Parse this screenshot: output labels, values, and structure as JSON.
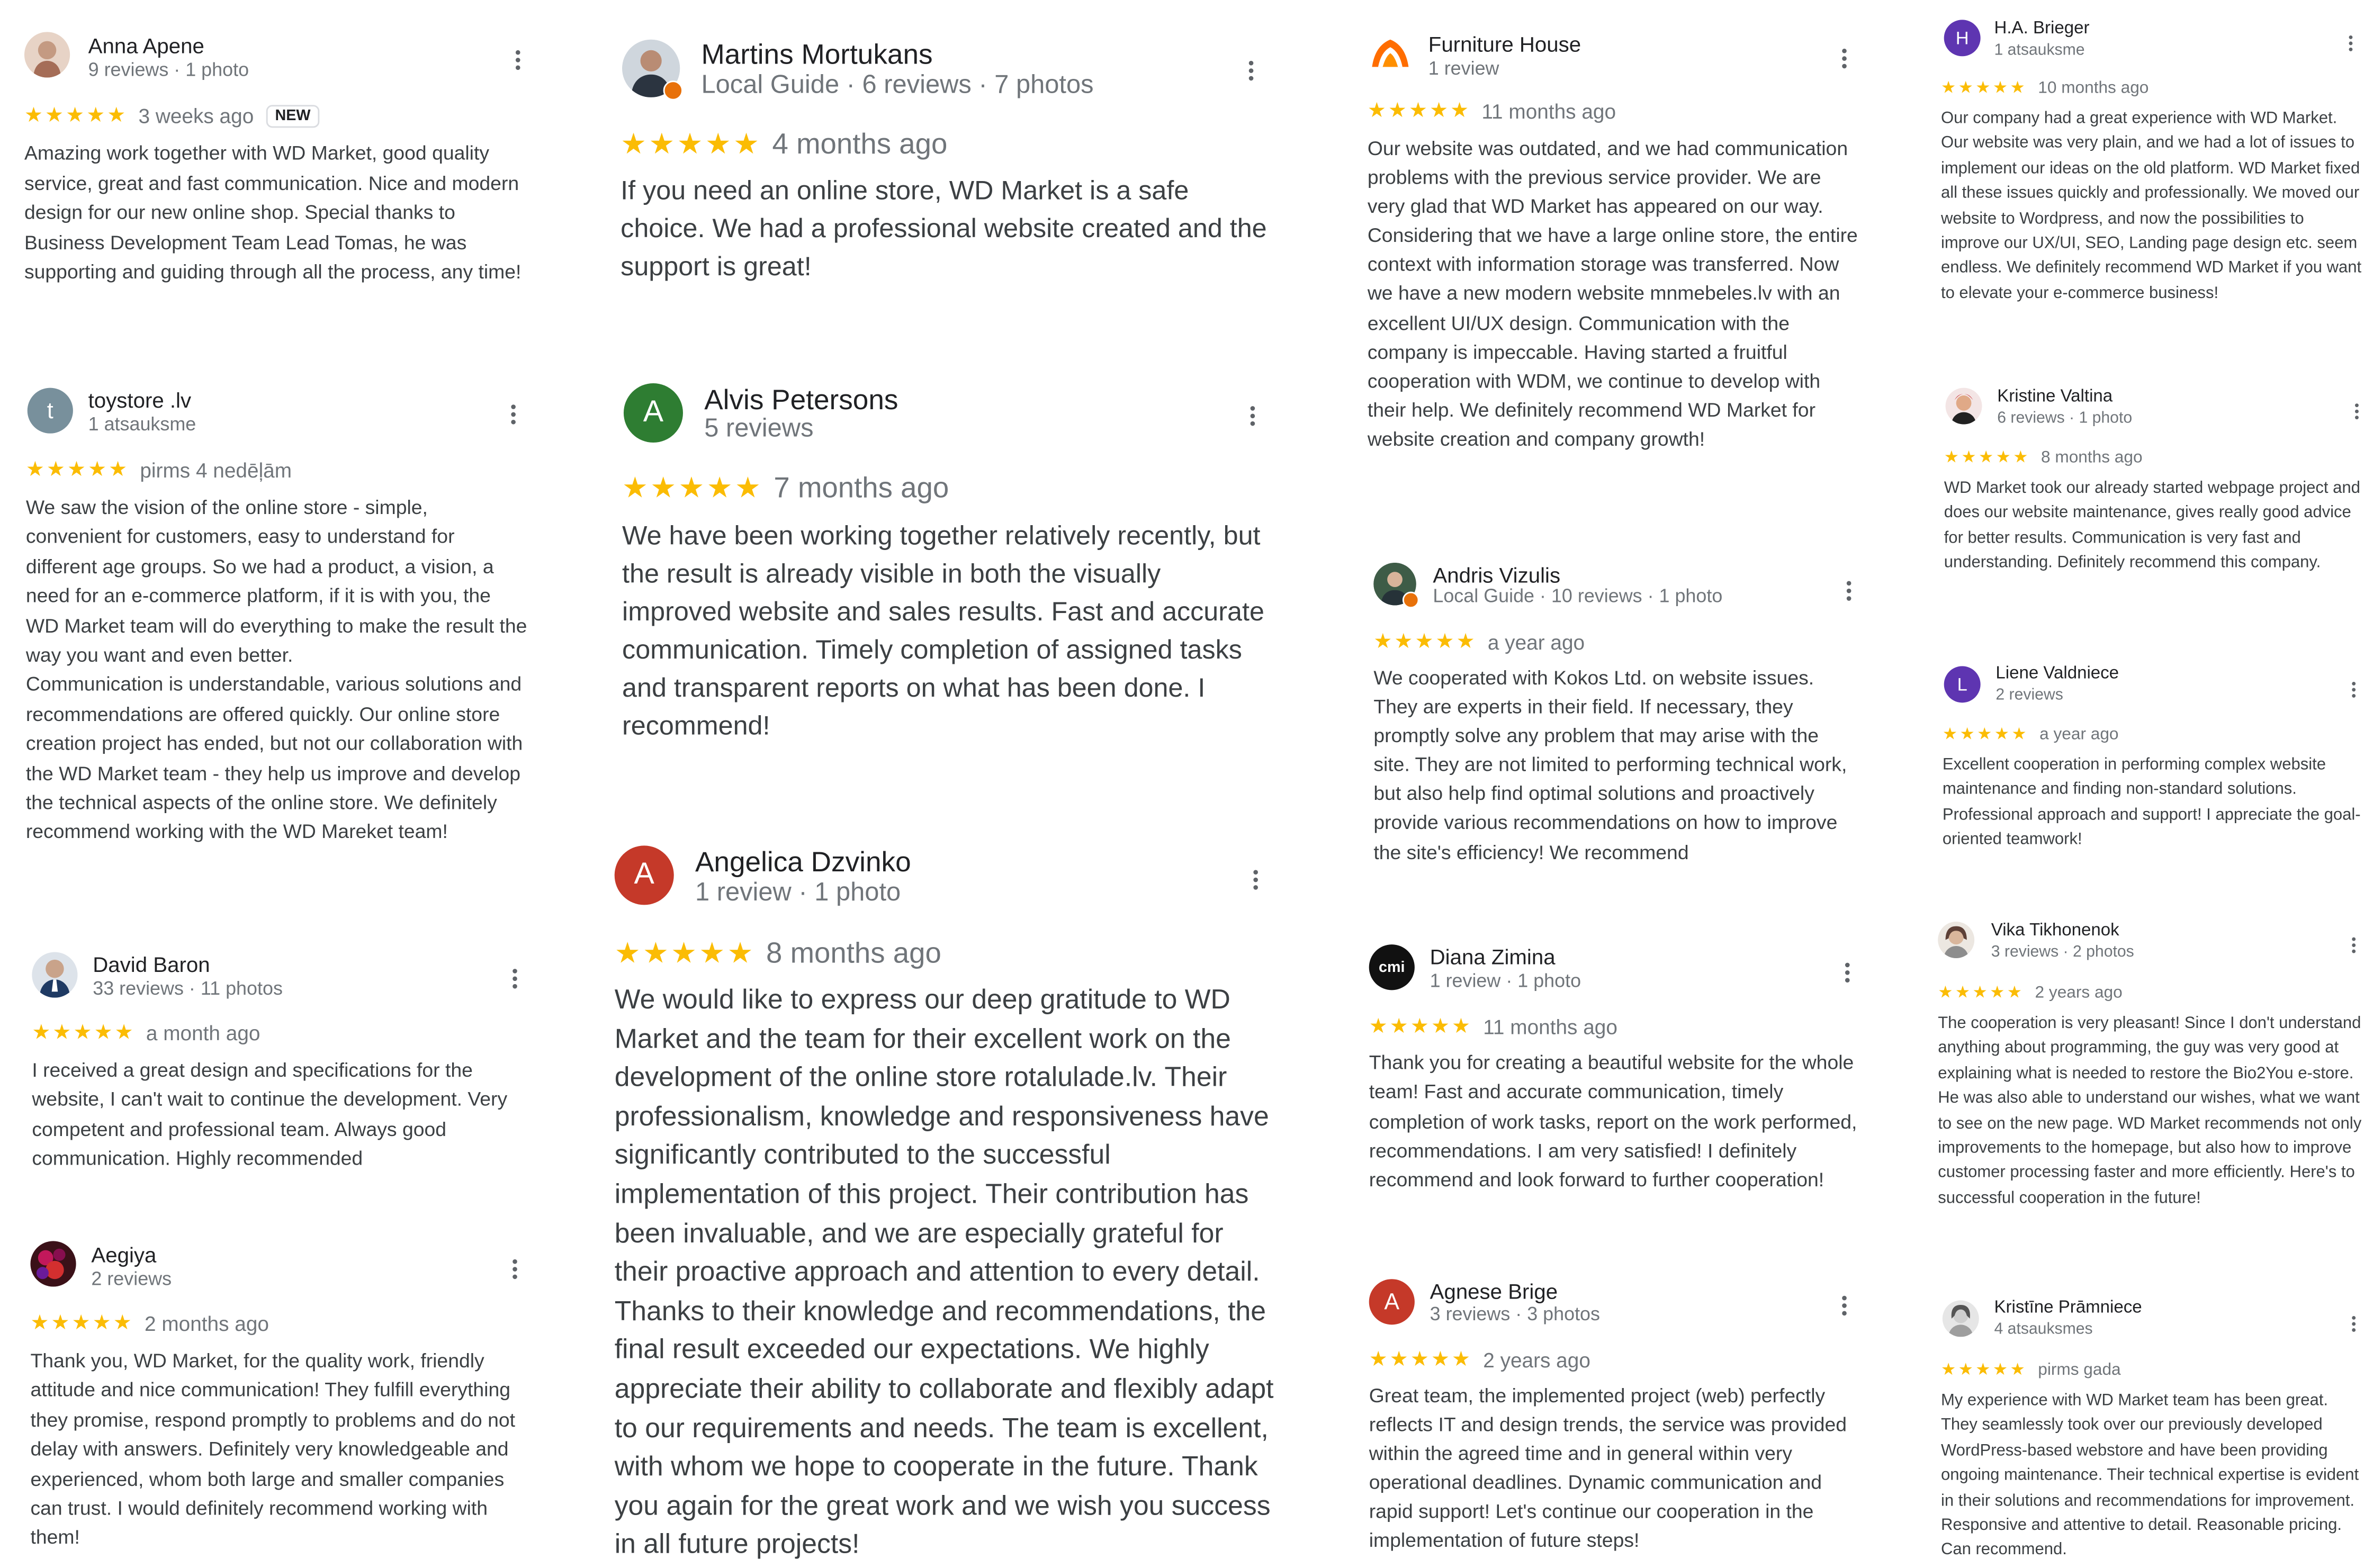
{
  "reviews": {
    "anna": {
      "name": "Anna Apene",
      "meta": "9 reviews · 1 photo",
      "stars": "★★★★★",
      "when": "3 weeks ago",
      "badge": "NEW",
      "text": "Amazing work together with WD Market, good quality service, great and fast communication. Nice and modern design for our new online shop. Special thanks to Business Development Team Lead Tomas, he was supporting and guiding through all the process, any time!"
    },
    "toystore": {
      "name": "toystore .lv",
      "initial": "t",
      "meta": "1 atsauksme",
      "stars": "★★★★★",
      "when": "pirms 4 nedēļām",
      "text": "We saw the vision of the online store - simple, convenient for customers, easy to understand for different age groups. So we had a product, a vision, a need for an e-commerce platform, if it is with you, the WD Market team will do everything to make the result the way you want and even better.\nCommunication is understandable, various solutions and recommendations are offered quickly. Our online store creation project has ended, but not our collaboration with the WD Market team - they help us improve and develop the technical aspects of the online store. We definitely recommend working with the WD Mareket team!"
    },
    "david": {
      "name": "David Baron",
      "meta": "33 reviews · 11 photos",
      "stars": "★★★★★",
      "when": "a month ago",
      "text": "I received a great design and specifications for the website, I can't wait to continue the development. Very competent and professional team. Always good communication. Highly recommended"
    },
    "aegiya": {
      "name": "Aegiya",
      "meta": "2 reviews",
      "stars": "★★★★★",
      "when": "2 months ago",
      "text": "Thank you, WD Market, for the quality work, friendly attitude and nice communication! They fulfill everything they promise, respond promptly to problems and do not delay with answers. Definitely very knowledgeable and experienced, whom both large and smaller companies can trust. I would definitely recommend working with them!"
    },
    "martins": {
      "name": "Martins Mortukans",
      "meta": "Local Guide · 6 reviews · 7 photos",
      "stars": "★★★★★",
      "when": "4 months ago",
      "text": "If you need an online store, WD Market is a safe choice. We had a professional website created and the support is great!"
    },
    "alvis": {
      "name": "Alvis Petersons",
      "initial": "A",
      "meta": "5 reviews",
      "stars": "★★★★★",
      "when": "7 months ago",
      "text": "We have been working together relatively recently, but the result is already visible in both the visually improved website and sales results. Fast and accurate communication. Timely completion of assigned tasks and transparent reports on what has been done. I recommend!"
    },
    "angelica": {
      "name": "Angelica Dzvinko",
      "initial": "A",
      "meta": "1 review · 1 photo",
      "stars": "★★★★★",
      "when": "8 months ago",
      "text": "We would like to express our deep gratitude to WD Market and the team for their excellent work on the development of the online store rotalulade.lv. Their professionalism, knowledge and responsiveness have significantly contributed to the successful implementation of this project. Their contribution has been invaluable, and we are especially grateful for their proactive approach and attention to every detail. Thanks to their knowledge and recommendations, the final result exceeded our expectations. We highly appreciate their ability to collaborate and flexibly adapt to our requirements and needs. The team is excellent, with whom we hope to cooperate in the future. Thank you again for the great work and we wish you success in all future projects!"
    },
    "furniture": {
      "name": "Furniture House",
      "meta": "1 review",
      "stars": "★★★★★",
      "when": "11 months ago",
      "text": "Our website was outdated, and we had communication problems with the previous service provider. We are very glad that WD Market has appeared on our way. Considering that we have a large online store, the entire context with information storage was transferred. Now we have a new modern website mnmebeles.lv with an excellent UI/UX design. Communication with the company is impeccable. Having started a fruitful cooperation with WDM, we continue to develop with their help. We definitely recommend WD Market for website creation and company growth!"
    },
    "andris": {
      "name": "Andris Vizulis",
      "meta": "Local Guide · 10 reviews · 1 photo",
      "stars": "★★★★★",
      "when": "a year ago",
      "text": "We cooperated with Kokos Ltd. on website issues. They are experts in their field. If necessary, they promptly solve any problem that may arise with the site. They are not limited to performing technical work, but also help find optimal solutions and proactively provide various recommendations on how to improve the site's efficiency! We recommend"
    },
    "diana": {
      "name": "Diana Zimina",
      "logo": "cmi",
      "meta": "1 review · 1 photo",
      "stars": "★★★★★",
      "when": "11 months ago",
      "text": "Thank you for creating a beautiful website for the whole team! Fast and accurate communication, timely completion of work tasks, report on the work performed, recommendations. I am very satisfied! I definitely recommend and look forward to further cooperation!"
    },
    "agnese": {
      "name": "Agnese Brige",
      "initial": "A",
      "meta": "3 reviews · 3 photos",
      "stars": "★★★★★",
      "when": "2 years ago",
      "text": "Great team, the implemented project (web) perfectly reflects IT and design trends, the service was provided within the agreed time and in general within very operational deadlines. Dynamic communication and rapid support! Let's continue our cooperation in the implementation of future steps!"
    },
    "ha": {
      "name": "H.A. Brieger",
      "initial": "H",
      "meta": "1 atsauksme",
      "stars": "★★★★★",
      "when": "10 months ago",
      "text": "Our company had a great experience with WD Market. Our website was very plain, and we had a lot of issues to implement our ideas on the old platform. WD Market fixed all these issues quickly and professionally. We moved our website to Wordpress, and now the possibilities to improve our UX/UI, SEO, Landing page design etc. seem endless. We definitely recommend WD Market if you want to elevate your e-commerce business!"
    },
    "kristine_v": {
      "name": "Kristine Valtina",
      "meta": "6 reviews · 1 photo",
      "stars": "★★★★★",
      "when": "8 months ago",
      "text": "WD Market took our already started webpage project and does our website maintenance, gives really good advice for better results. Communication is very fast and understanding. Definitely recommend this company."
    },
    "liene": {
      "name": "Liene Valdniece",
      "initial": "L",
      "meta": "2 reviews",
      "stars": "★★★★★",
      "when": "a year ago",
      "text": "Excellent cooperation in performing complex website maintenance and finding non-standard solutions. Professional approach and support! I appreciate the goal-oriented teamwork!"
    },
    "vika": {
      "name": "Vika Tikhonenok",
      "meta": "3 reviews · 2 photos",
      "stars": "★★★★★",
      "when": "2 years ago",
      "text": "The cooperation is very pleasant! Since I don't understand anything about programming, the guy was very good at explaining what is needed to restore the Bio2You e-store. He was also able to understand our wishes, what we want to see on the new page. WD Market recommends not only improvements to the homepage, but also how to improve customer processing faster and more efficiently. Here's to successful cooperation in the future!"
    },
    "kristine_p": {
      "name": "Kristīne Prāmniece",
      "meta": "4 atsauksmes",
      "stars": "★★★★★",
      "when": "pirms gada",
      "text": "My experience with WD Market team has been great. They seamlessly took over our previously developed WordPress-based webstore and have been providing ongoing maintenance. Their technical expertise is evident in their solutions and recommendations for improvement. Responsive and attentive to detail. Reasonable pricing. Can recommend."
    }
  },
  "colors": {
    "star": "#fbbc04",
    "toystore_avatar": "#78909c",
    "alvis_avatar": "#2e7d32",
    "angelica_avatar": "#c53929",
    "agnese_avatar": "#c53929",
    "ha_avatar": "#5e35b1",
    "liene_avatar": "#5e35b1"
  }
}
